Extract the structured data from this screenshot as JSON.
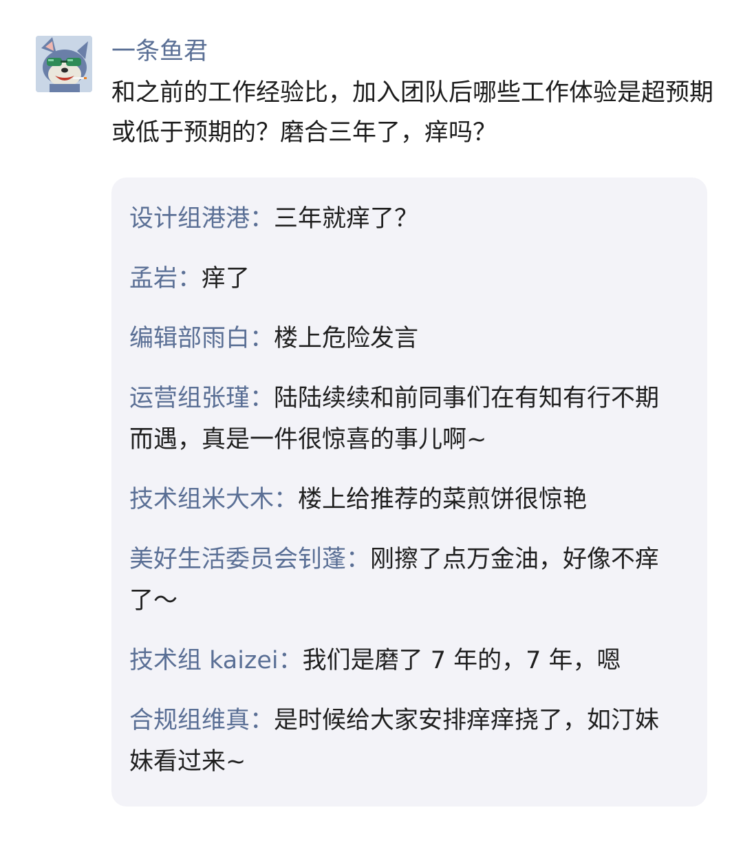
{
  "post": {
    "author": "一条鱼君",
    "question": "和之前的工作经验比，加入团队后哪些工作体验是超预期或低于预期的？磨合三年了，痒吗？"
  },
  "replies": [
    {
      "name": "设计组港港",
      "colon": "：",
      "text": "三年就痒了？"
    },
    {
      "name": "孟岩",
      "colon": "：",
      "text": "痒了"
    },
    {
      "name": "编辑部雨白",
      "colon": "：",
      "text": "楼上危险发言"
    },
    {
      "name": "运营组张瑾",
      "colon": "：",
      "text": "陆陆续续和前同事们在有知有行不期而遇，真是一件很惊喜的事儿啊~"
    },
    {
      "name": "技术组米大木",
      "colon": "：",
      "text": "楼上给推荐的菜煎饼很惊艳"
    },
    {
      "name": "美好生活委员会钊蓬",
      "colon": "：",
      "text": "刚擦了点万金油，好像不痒了～"
    },
    {
      "name": "技术组 kaizei",
      "colon": "：",
      "text": "我们是磨了 7 年的，7 年，嗯"
    },
    {
      "name": "合规组维真",
      "colon": "：",
      "text": "是时候给大家安排痒痒挠了，如汀妹妹看过来~"
    }
  ],
  "colors": {
    "name": "#5a6f95",
    "text": "#1f1f1f",
    "box": "#f3f3f8"
  }
}
